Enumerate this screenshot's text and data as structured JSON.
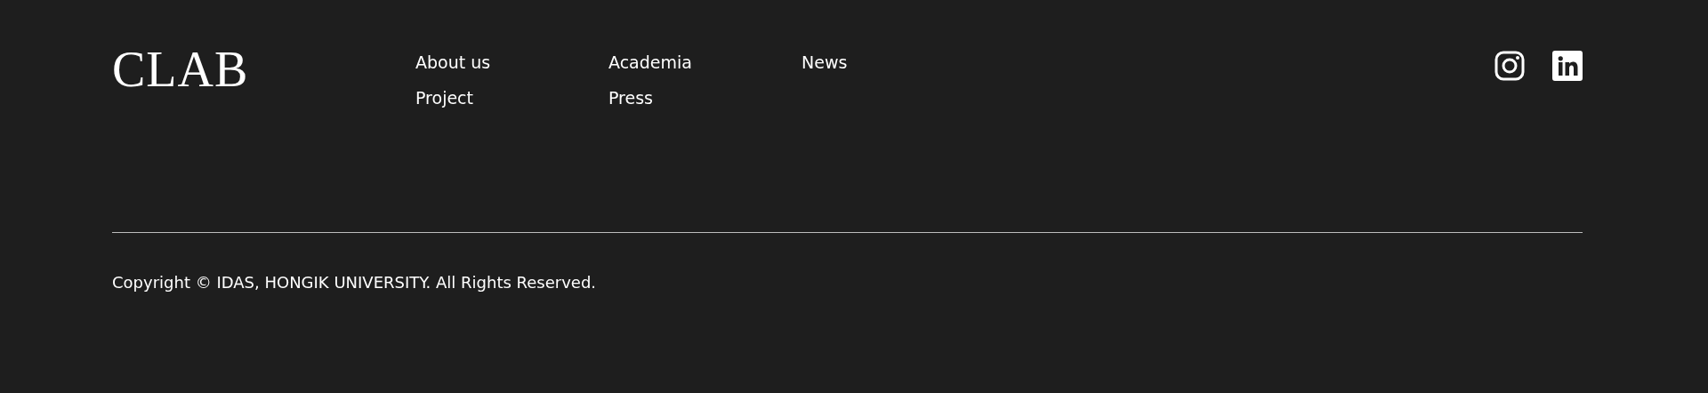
{
  "logo": {
    "text": "CLAB"
  },
  "nav": [
    {
      "label": "About us"
    },
    {
      "label": "Academia"
    },
    {
      "label": "News"
    },
    {
      "label": "Project"
    },
    {
      "label": "Press"
    }
  ],
  "social": [
    {
      "kind": "instagram"
    },
    {
      "kind": "linkedin"
    }
  ],
  "copyright": "Copyright © IDAS, HONGIK UNIVERSITY. All Rights Reserved."
}
